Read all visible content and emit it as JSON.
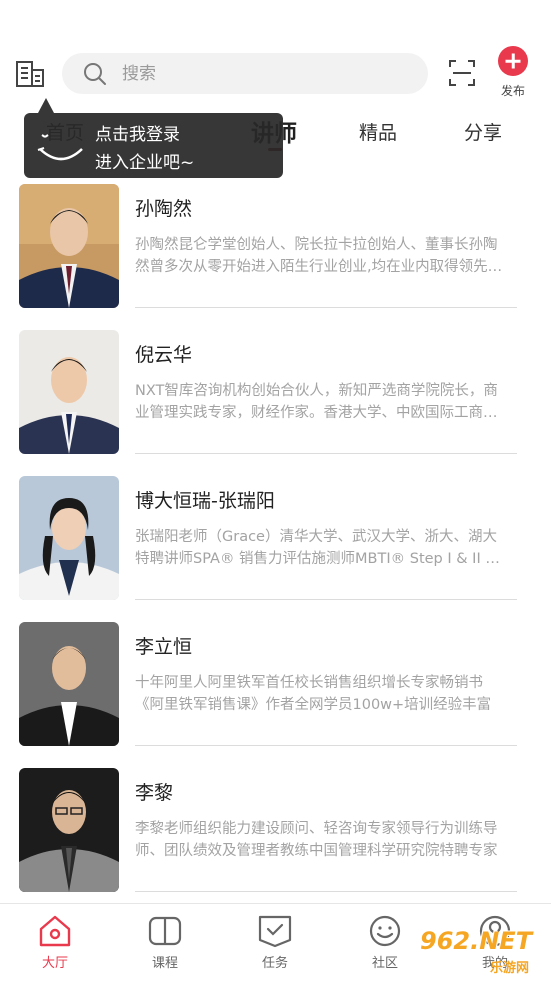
{
  "header": {
    "search_placeholder": "搜索",
    "publish_label": "发布"
  },
  "tabs": [
    {
      "label": "首页"
    },
    {
      "label": "讲师"
    },
    {
      "label": "精品"
    },
    {
      "label": "分享"
    }
  ],
  "active_tab": "讲师",
  "tooltip": {
    "line1": "点击我登录",
    "line2": "进入企业吧~"
  },
  "lecturers": [
    {
      "name": "孙陶然",
      "desc": "孙陶然昆仑学堂创始人、院长拉卡拉创始人、董事长孙陶然曾多次从零开始进入陌生行业创业,均在业内取得领先地位"
    },
    {
      "name": "倪云华",
      "desc": "NXT智库咨询机构创始合伙人，新知严选商学院院长，商业管理实践专家，财经作家。香港大学、中欧国际工商学院"
    },
    {
      "name": "博大恒瑞-张瑞阳",
      "desc": "张瑞阳老师（Grace）清华大学、武汉大学、浙大、湖大特聘讲师SPA® 销售力评估施测师MBTI® Step I & II 认证施测师"
    },
    {
      "name": "李立恒",
      "desc": "十年阿里人阿里铁军首任校长销售组织增长专家畅销书《阿里铁军销售课》作者全网学员100w+培训经验丰富"
    },
    {
      "name": "李黎",
      "desc": "李黎老师组织能力建设顾问、轻咨询专家领导行为训练导师、团队绩效及管理者教练中国管理科学研究院特聘专家"
    }
  ],
  "bottom_nav": [
    {
      "label": "大厅",
      "icon": "home-icon"
    },
    {
      "label": "课程",
      "icon": "book-icon"
    },
    {
      "label": "任务",
      "icon": "task-check-icon"
    },
    {
      "label": "社区",
      "icon": "community-smile-icon"
    },
    {
      "label": "我的",
      "icon": "profile-icon"
    }
  ],
  "watermark": {
    "big": "962.NET",
    "small": "乐游网"
  },
  "colors": {
    "accent": "#e8394d",
    "tab_indicator": "#7a1f2b",
    "tooltip_bg": "#282828",
    "desc_text": "#a3a3a3"
  }
}
